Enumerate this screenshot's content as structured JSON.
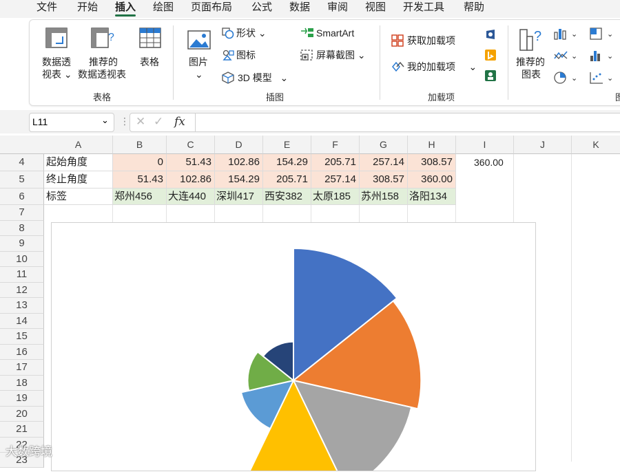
{
  "menu": {
    "tabs": [
      "文件",
      "开始",
      "插入",
      "绘图",
      "页面布局",
      "公式",
      "数据",
      "审阅",
      "视图",
      "开发工具",
      "帮助"
    ],
    "active_tab": "插入"
  },
  "ribbon": {
    "tables": {
      "label": "表格",
      "pivot_line1": "数据透",
      "pivot_line2": "视表",
      "recommended_line1": "推荐的",
      "recommended_line2": "数据透视表",
      "table": "表格"
    },
    "illustrations": {
      "label": "插图",
      "pictures": "图片",
      "shapes": "形状",
      "icons": "图标",
      "models3d": "3D 模型",
      "smartart": "SmartArt",
      "screenshot": "屏幕截图"
    },
    "addins": {
      "label": "加载项",
      "get": "获取加载项",
      "my": "我的加载项"
    },
    "charts": {
      "label": "图",
      "recommended_line1": "推荐的",
      "recommended_line2": "图表"
    }
  },
  "formula_bar": {
    "name_box": "L11",
    "fx": "fx",
    "value": ""
  },
  "columns": [
    "A",
    "B",
    "C",
    "D",
    "E",
    "F",
    "G",
    "H",
    "I",
    "J",
    "K"
  ],
  "rows": [
    {
      "num": "4",
      "label": "起始角度",
      "values": [
        "0",
        "51.43",
        "102.86",
        "154.29",
        "205.71",
        "257.14",
        "308.57"
      ],
      "extra": "360.00"
    },
    {
      "num": "5",
      "label": "终止角度",
      "values": [
        "51.43",
        "102.86",
        "154.29",
        "205.71",
        "257.14",
        "308.57",
        "360.00"
      ],
      "extra": ""
    },
    {
      "num": "6",
      "label": "标签",
      "values": [
        "郑州456",
        "大连440",
        "深圳417",
        "西安382",
        "太原185",
        "苏州158",
        "洛阳134"
      ],
      "extra": ""
    }
  ],
  "row_numbers": [
    "7",
    "8",
    "9",
    "10",
    "11",
    "12",
    "13",
    "14",
    "15",
    "16",
    "17",
    "18",
    "19",
    "20",
    "21",
    "22",
    "23"
  ],
  "chart_data": {
    "type": "pie",
    "categories": [
      "郑州",
      "大连",
      "深圳",
      "西安",
      "太原",
      "苏州",
      "洛阳"
    ],
    "values": [
      456,
      440,
      417,
      382,
      185,
      158,
      134
    ],
    "start_angles": [
      0,
      51.43,
      102.86,
      154.29,
      205.71,
      257.14,
      308.57
    ],
    "end_angles": [
      51.43,
      102.86,
      154.29,
      205.71,
      257.14,
      308.57,
      360.0
    ],
    "colors": [
      "#4472C4",
      "#ED7D31",
      "#A5A5A5",
      "#FFC000",
      "#5B9BD5",
      "#70AD47",
      "#264478"
    ]
  },
  "watermark": "大数跨境"
}
